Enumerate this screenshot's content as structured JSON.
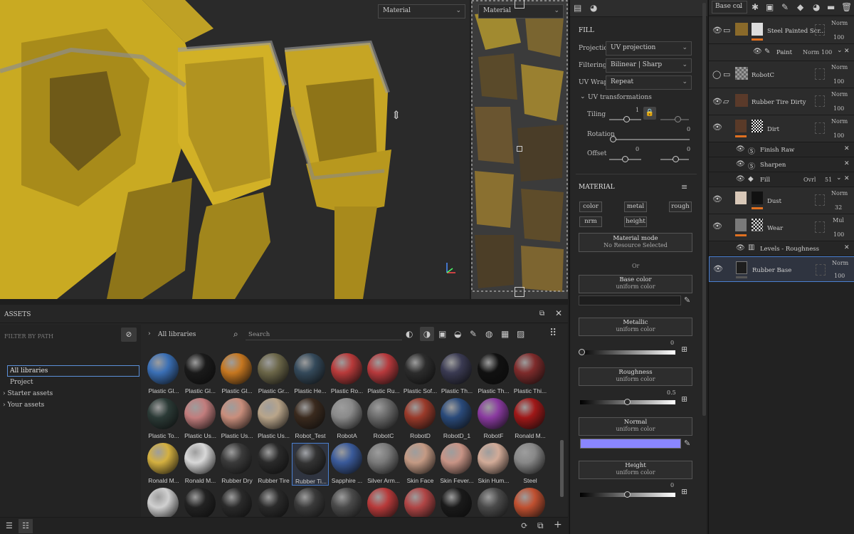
{
  "viewport": {
    "left_mode": "Material",
    "right_mode": "Material"
  },
  "assets": {
    "title": "ASSETS",
    "filter_label": "FILTER BY PATH",
    "breadcrumb": "All libraries",
    "search_placeholder": "Search",
    "tree": [
      {
        "label": "All libraries",
        "selected": true
      },
      {
        "label": "Project",
        "selected": false
      },
      {
        "label": "Starter assets",
        "selected": false
      },
      {
        "label": "Your assets",
        "selected": false
      }
    ],
    "items": [
      {
        "label": "Plastic Gl...",
        "color": "#3a6fb5"
      },
      {
        "label": "Plastic Gl...",
        "color": "#1a1a1a"
      },
      {
        "label": "Plastic Gl...",
        "color": "#c67720"
      },
      {
        "label": "Plastic Gr...",
        "color": "#6b6648"
      },
      {
        "label": "Plastic He...",
        "color": "#34495a"
      },
      {
        "label": "Plastic Ro...",
        "color": "#b83a3a"
      },
      {
        "label": "Plastic Ru...",
        "color": "#b7393c"
      },
      {
        "label": "Plastic Sof...",
        "color": "#2c2c2c"
      },
      {
        "label": "Plastic Th...",
        "color": "#3a3a52"
      },
      {
        "label": "Plastic Th...",
        "color": "#111111"
      },
      {
        "label": "Plastic Thi...",
        "color": "#7e2b2b"
      },
      {
        "label": "Plastic To...",
        "color": "#2b3a36"
      },
      {
        "label": "Plastic Us...",
        "color": "#c27d7d"
      },
      {
        "label": "Plastic Us...",
        "color": "#c98e7c"
      },
      {
        "label": "Plastic Us...",
        "color": "#b9a58a"
      },
      {
        "label": "Robot_Test",
        "color": "#3a2a1e"
      },
      {
        "label": "RobotA",
        "color": "#8a8a8a"
      },
      {
        "label": "RobotC",
        "color": "#6a6a6a"
      },
      {
        "label": "RobotD",
        "color": "#9a3a2a"
      },
      {
        "label": "RobotD_1",
        "color": "#2a4a7a"
      },
      {
        "label": "RobotF",
        "color": "#8a3aa0"
      },
      {
        "label": "Ronald M...",
        "color": "#a01818"
      },
      {
        "label": "Ronald M...",
        "color": "#d4b040"
      },
      {
        "label": "Ronald M...",
        "color": "#d8d8d8"
      },
      {
        "label": "Rubber Dry",
        "color": "#3a3a3a"
      },
      {
        "label": "Rubber Tire",
        "color": "#2a2a2a"
      },
      {
        "label": "Rubber Ti...",
        "color": "#333333"
      },
      {
        "label": "Sapphire ...",
        "color": "#3a5a9a"
      },
      {
        "label": "Silver Arm...",
        "color": "#7a7a7a"
      },
      {
        "label": "Skin Face",
        "color": "#c49a84"
      },
      {
        "label": "Skin Fever...",
        "color": "#c89486"
      },
      {
        "label": "Skin Hum...",
        "color": "#d2ab98"
      },
      {
        "label": "Steel",
        "color": "#888888"
      },
      {
        "label": "",
        "color": "#d0d0d0"
      },
      {
        "label": "",
        "color": "#222222"
      },
      {
        "label": "",
        "color": "#2a2a2a"
      },
      {
        "label": "",
        "color": "#2a2a2a"
      },
      {
        "label": "",
        "color": "#3a3a3a"
      },
      {
        "label": "",
        "color": "#4a4a4a"
      },
      {
        "label": "",
        "color": "#b83a3a"
      },
      {
        "label": "",
        "color": "#b04545"
      },
      {
        "label": "",
        "color": "#1a1a1a"
      },
      {
        "label": "",
        "color": "#4a4a4a"
      },
      {
        "label": "",
        "color": "#c05030"
      }
    ],
    "selected_index": 26
  },
  "props": {
    "fill_title": "FILL",
    "projection_label": "Projection",
    "projection_value": "UV projection",
    "filtering_label": "Filtering",
    "filtering_value": "Bilinear | Sharp",
    "uvwrap_label": "UV Wrap",
    "uvwrap_value": "Repeat",
    "uvtrans_title": "UV transformations",
    "tiling_label": "Tiling",
    "tiling_value": "1",
    "rotation_label": "Rotation",
    "rotation_value": "0",
    "offset_label": "Offset",
    "offset_value_1": "0",
    "offset_value_2": "0",
    "material_title": "MATERIAL",
    "channels": [
      "color",
      "metal",
      "rough",
      "nrm",
      "height"
    ],
    "material_mode_label": "Material mode",
    "material_mode_value": "No Resource Selected",
    "or_label": "Or",
    "base_color_label": "Base color",
    "uniform_color": "uniform color",
    "metallic_label": "Metallic",
    "metallic_value": "0",
    "roughness_label": "Roughness",
    "roughness_value": "0.5",
    "normal_label": "Normal",
    "normal_color": "#8a86ff",
    "height_label": "Height",
    "height_value": "0"
  },
  "layers": {
    "channel": "Base col",
    "rows": [
      {
        "name": "Steel Painted Scr...",
        "blend": "Norm",
        "opacity": "100",
        "type": "folder"
      },
      {
        "name": "Paint",
        "blend": "Norm",
        "opacity": "100",
        "type": "sub"
      },
      {
        "name": "RobotC",
        "blend": "Norm",
        "opacity": "100",
        "type": "folder"
      },
      {
        "name": "Rubber Tire Dirty",
        "blend": "Norm",
        "opacity": "100",
        "type": "folder"
      },
      {
        "name": "Dirt",
        "blend": "Norm",
        "opacity": "100",
        "type": "layer"
      },
      {
        "name": "Finish Raw",
        "type": "effect"
      },
      {
        "name": "Sharpen",
        "type": "effect"
      },
      {
        "name": "Fill",
        "blend": "Ovrl",
        "opacity": "51",
        "type": "fill"
      },
      {
        "name": "Dust",
        "blend": "Norm",
        "opacity": "32",
        "type": "layer"
      },
      {
        "name": "Wear",
        "blend": "Mul",
        "opacity": "100",
        "type": "layer"
      },
      {
        "name": "Levels - Roughness",
        "type": "effect"
      },
      {
        "name": "Rubber Base",
        "blend": "Norm",
        "opacity": "100",
        "type": "layer"
      }
    ]
  }
}
